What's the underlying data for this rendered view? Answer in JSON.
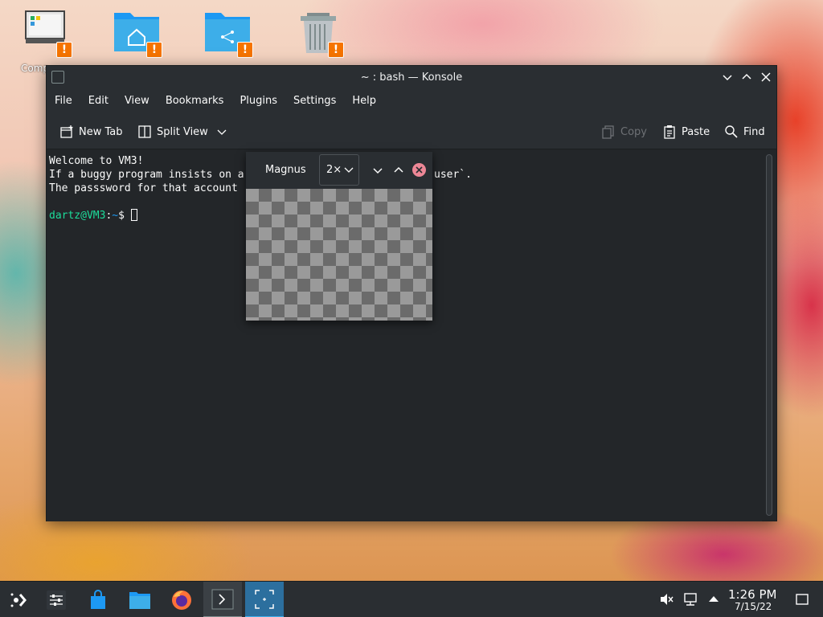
{
  "desktop": {
    "icons": [
      {
        "name": "computer",
        "label": "Comp",
        "badge": "!"
      },
      {
        "name": "home-folder",
        "label": "",
        "badge": "!"
      },
      {
        "name": "network-folder",
        "label": "",
        "badge": "!"
      },
      {
        "name": "trash",
        "label": "",
        "badge": "!"
      }
    ]
  },
  "window": {
    "title": "~ : bash — Konsole",
    "menu": [
      "File",
      "Edit",
      "View",
      "Bookmarks",
      "Plugins",
      "Settings",
      "Help"
    ],
    "toolbar": {
      "new_tab": "New Tab",
      "split_view": "Split View",
      "copy": "Copy",
      "paste": "Paste",
      "find": "Find"
    },
    "terminal": {
      "lines": [
        "Welcome to VM3!",
        "If a buggy program insists on a",
        "The passsword for that account"
      ],
      "line2_tail": "user`.",
      "prompt_user": "dartz@VM3",
      "prompt_sep": ":",
      "prompt_path": "~",
      "prompt_symbol": "$"
    }
  },
  "magnus": {
    "title": "Magnus",
    "zoom": "2×"
  },
  "taskbar": {
    "clock_time": "1:26 PM",
    "clock_date": "7/15/22",
    "colors": {
      "accent": "#3daee9",
      "panel": "#2a2e32"
    }
  }
}
